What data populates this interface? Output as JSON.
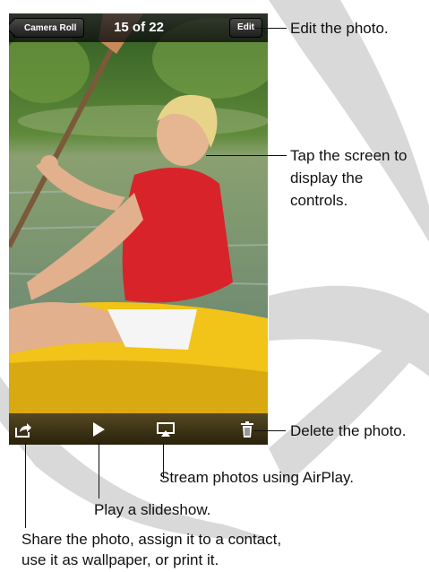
{
  "navbar": {
    "back_label": "Camera Roll",
    "title": "15 of 22",
    "edit_label": "Edit"
  },
  "toolbar": {
    "icons": [
      "share-icon",
      "play-icon",
      "airplay-icon",
      "trash-icon"
    ]
  },
  "callouts": {
    "edit": "Edit the photo.",
    "tap_line1": "Tap the screen to",
    "tap_line2": "display the",
    "tap_line3": "controls.",
    "delete": "Delete the photo.",
    "airplay": "Stream photos using AirPlay.",
    "play": "Play a slideshow.",
    "share_line1": "Share the photo, assign it to a contact,",
    "share_line2": "use it as wallpaper, or print it."
  },
  "colors": {
    "swoosh": "#d9d9d9",
    "navbar": "#1a1a1a",
    "shirt": "#d8232a",
    "kayak": "#f2c318",
    "water": "#6e8a7a",
    "foliage": "#4a7a2c"
  }
}
